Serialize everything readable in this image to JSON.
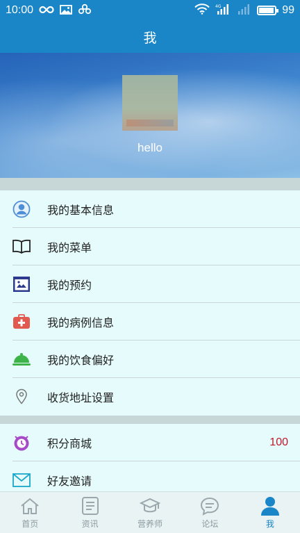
{
  "status_bar": {
    "time": "10:00",
    "battery_level": "99",
    "battery_fill_percent": 95,
    "icons": [
      "infinity-icon",
      "image-icon",
      "clover-icon",
      "wifi-icon",
      "signal-4g-icon",
      "signal-icon",
      "battery-icon"
    ]
  },
  "header": {
    "title": "我"
  },
  "profile": {
    "username": "hello"
  },
  "menu_group_1": [
    {
      "label": "我的基本信息",
      "icon": "user-circle-icon"
    },
    {
      "label": "我的菜单",
      "icon": "book-icon"
    },
    {
      "label": "我的预约",
      "icon": "calendar-card-icon"
    },
    {
      "label": "我的病例信息",
      "icon": "medical-kit-icon"
    },
    {
      "label": "我的饮食偏好",
      "icon": "food-cloche-icon"
    },
    {
      "label": "收货地址设置",
      "icon": "location-pin-icon"
    }
  ],
  "menu_group_2": [
    {
      "label": "积分商城",
      "icon": "points-clock-icon",
      "value": "100"
    },
    {
      "label": "好友邀请",
      "icon": "mail-icon"
    }
  ],
  "tabs": [
    {
      "label": "首页",
      "icon": "home-icon",
      "active": false
    },
    {
      "label": "资讯",
      "icon": "news-icon",
      "active": false
    },
    {
      "label": "营养师",
      "icon": "graduation-cap-icon",
      "active": false
    },
    {
      "label": "论坛",
      "icon": "chat-bubble-icon",
      "active": false
    },
    {
      "label": "我",
      "icon": "person-icon",
      "active": true
    }
  ],
  "colors": {
    "primary": "#1a86c7",
    "background": "#e6fbfb",
    "divider": "#c9d6d6",
    "points_value": "#c0182b",
    "tab_inactive": "#8c9aa0"
  }
}
